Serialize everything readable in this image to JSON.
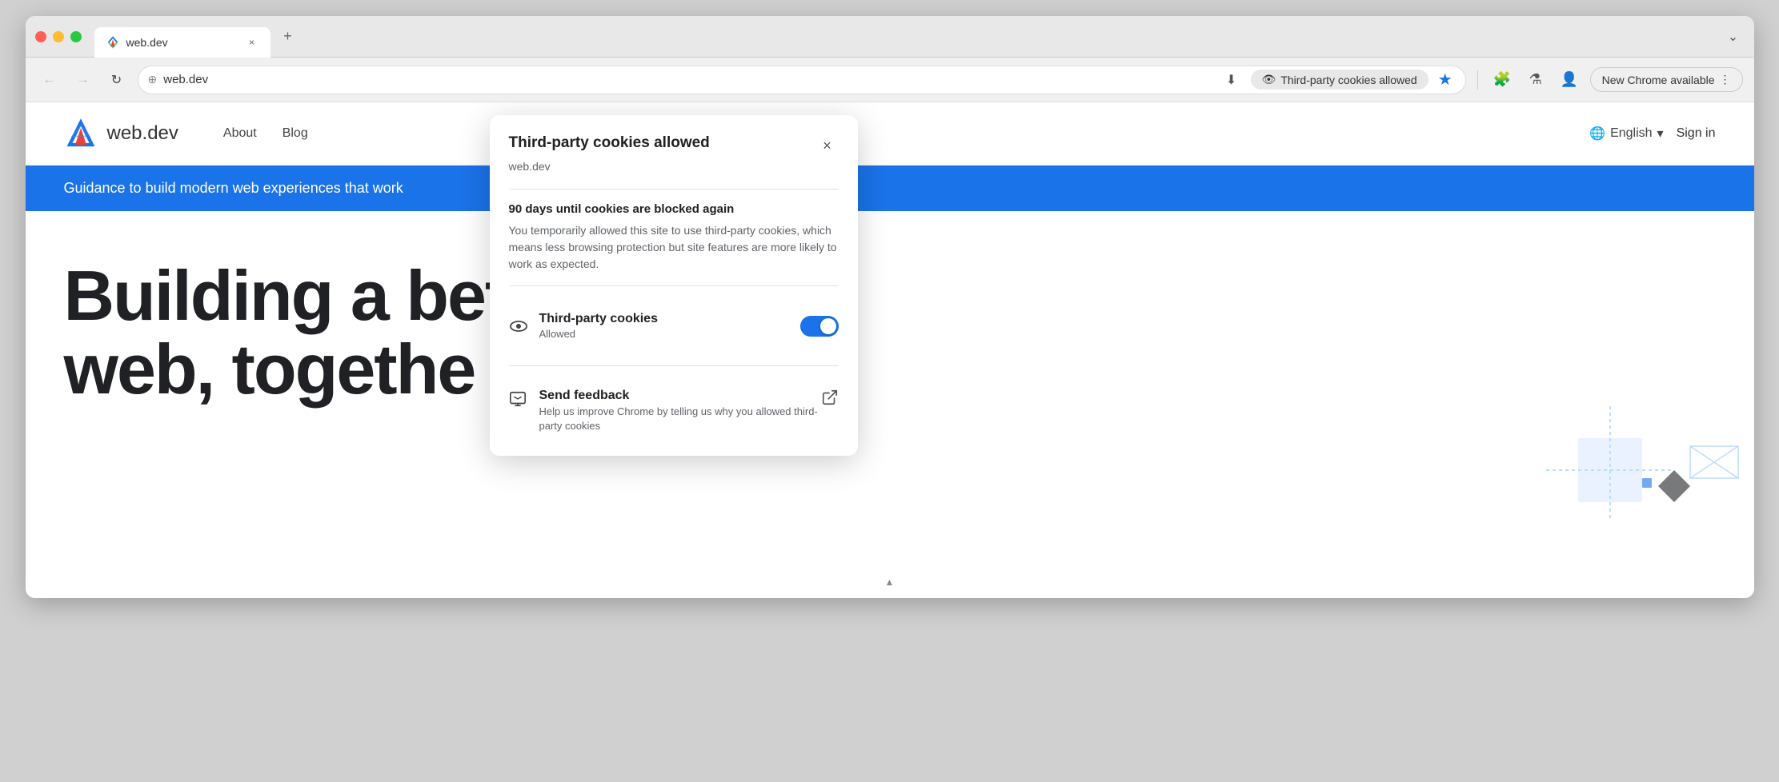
{
  "browser": {
    "tab": {
      "title": "web.dev",
      "close_label": "×",
      "new_tab_label": "+"
    },
    "nav": {
      "back_label": "←",
      "forward_label": "→",
      "refresh_label": "↻",
      "address": "web.dev",
      "cookie_pill_label": "Third-party cookies allowed",
      "new_chrome_label": "New Chrome available",
      "more_label": "⋮",
      "dropdown_label": "⌄"
    }
  },
  "site": {
    "logo_text": "web.dev",
    "nav_items": [
      "About",
      "Blog"
    ],
    "lang_label": "English",
    "sign_in_label": "Sign in"
  },
  "banner": {
    "text": "Guidance to build modern web experiences that work"
  },
  "hero": {
    "line1": "Building a bet",
    "line2": "web, togethe"
  },
  "popup": {
    "title": "Third-party cookies allowed",
    "subtitle": "web.dev",
    "close_label": "×",
    "info_title": "90 days until cookies are blocked again",
    "info_text": "You temporarily allowed this site to use third-party cookies, which means less browsing protection but site features are more likely to work as expected.",
    "toggle_label": "Third-party cookies",
    "toggle_sublabel": "Allowed",
    "feedback_title": "Send feedback",
    "feedback_text": "Help us improve Chrome by telling us why you allowed third-party cookies"
  },
  "icons": {
    "eye": "👁",
    "globe": "🌐",
    "extensions": "🧩",
    "profile": "👤",
    "flask": "⚗",
    "screenshot": "⬛",
    "external_link": "↗",
    "feedback": "💬",
    "chevron": "▾",
    "star_filled": "★"
  },
  "colors": {
    "accent_blue": "#1a73e8",
    "star_color": "#1a73e8",
    "pill_bg": "#e8e8e8",
    "toggle_on": "#1a73e8",
    "banner_bg": "#1a73e8"
  }
}
